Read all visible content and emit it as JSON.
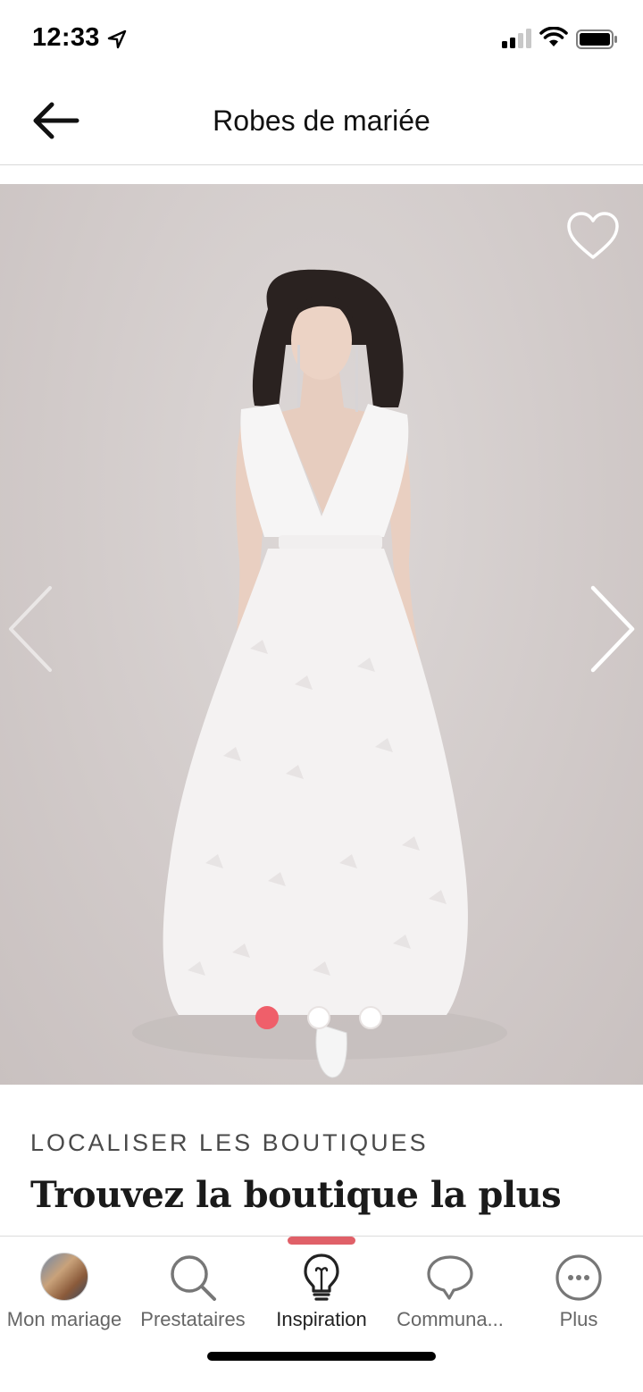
{
  "status_bar": {
    "time": "12:33"
  },
  "header": {
    "title": "Robes de mariée"
  },
  "carousel": {
    "slide_count": 3,
    "active_index": 0,
    "accent_color": "#ef5f6a"
  },
  "content": {
    "section_label": "LOCALISER LES BOUTIQUES",
    "headline": "Trouvez la boutique la plus"
  },
  "tabbar": {
    "active_color": "#e06068",
    "tabs": [
      {
        "label": "Mon mariage",
        "icon": "avatar"
      },
      {
        "label": "Prestataires",
        "icon": "search-icon"
      },
      {
        "label": "Inspiration",
        "icon": "lightbulb-icon",
        "active": true
      },
      {
        "label": "Communa...",
        "icon": "chat-bubble-icon"
      },
      {
        "label": "Plus",
        "icon": "more-icon"
      }
    ]
  }
}
